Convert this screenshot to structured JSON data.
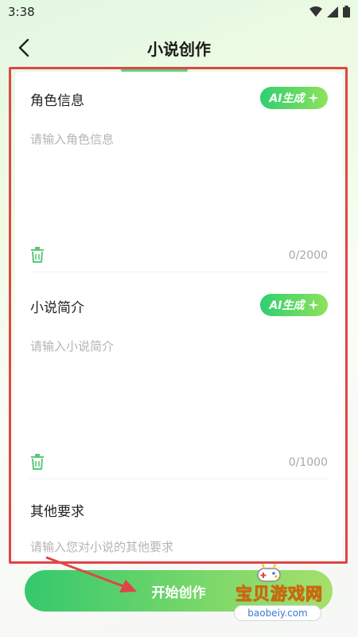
{
  "status_bar": {
    "time": "3:38",
    "icons": [
      "wifi-icon",
      "signal-icon",
      "battery-icon"
    ]
  },
  "header": {
    "title": "小说创作",
    "back_icon": "chevron-left-icon"
  },
  "sections": [
    {
      "title": "角色信息",
      "ai_button": "AI生成",
      "placeholder": "请输入角色信息",
      "counter": "0/2000"
    },
    {
      "title": "小说简介",
      "ai_button": "AI生成",
      "placeholder": "请输入小说简介",
      "counter": "0/1000"
    },
    {
      "title": "其他要求",
      "placeholder": "请输入您对小说的其他要求"
    }
  ],
  "start_button": {
    "label": "开始创作"
  },
  "watermark": {
    "text": "宝贝游戏网",
    "url": "baobeiy.com"
  },
  "colors": {
    "accent": "#4fcf6e",
    "highlight": "#e04545",
    "placeholder": "#b4b4b4"
  }
}
